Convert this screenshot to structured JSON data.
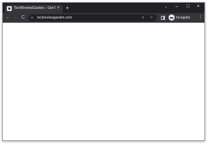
{
  "tab": {
    "title": "TechReviewGarden – Get Review",
    "close_glyph": "×"
  },
  "new_tab_glyph": "+",
  "window_controls": {
    "tab_search": "⌄",
    "minimize": "–",
    "maximize": "□",
    "close": "×"
  },
  "toolbar": {
    "back": "←",
    "forward": "→",
    "reload": "C",
    "url": "techreviewgarden.com",
    "site_info_icon": "≡",
    "zoom_icon": "⌕",
    "bookmark_icon": "☆",
    "profile_label": "Incognito",
    "menu": "⋮"
  },
  "colors": {
    "tabstrip": "#202124",
    "toolbar": "#35363a",
    "omnibox": "#202124",
    "text": "#e8eaed",
    "page": "#ffffff"
  }
}
